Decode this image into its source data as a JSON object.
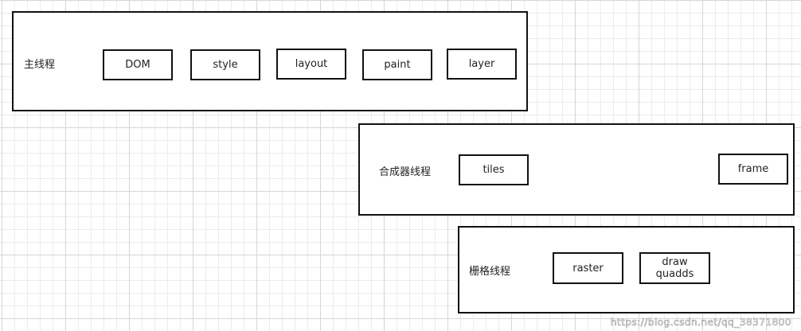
{
  "main_thread": {
    "label": "主线程",
    "nodes": [
      "DOM",
      "style",
      "layout",
      "paint",
      "layer"
    ]
  },
  "compositor_thread": {
    "label": "合成器线程",
    "nodes": [
      "tiles",
      "frame"
    ]
  },
  "raster_thread": {
    "label": "栅格线程",
    "nodes": [
      "raster"
    ],
    "draw_quads_lines": [
      "draw",
      "quadds"
    ]
  },
  "watermark": "https://blog.csdn.net/qq_38371800"
}
